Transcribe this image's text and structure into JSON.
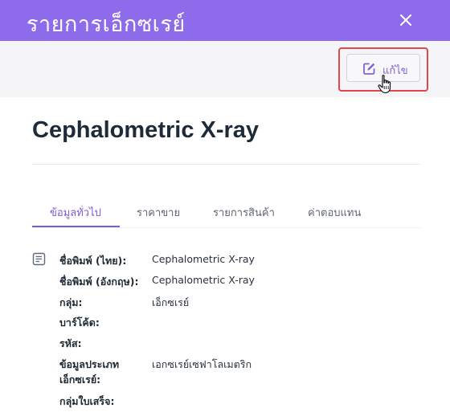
{
  "header": {
    "title": "รายการเอ็กซเรย์",
    "close_icon": "close-icon",
    "accent_color": "#8e6bea"
  },
  "toolbar": {
    "edit_label": "แก้ไข",
    "edit_icon": "edit-icon",
    "highlight_color": "#e0474c"
  },
  "product": {
    "title": "Cephalometric X-ray"
  },
  "tabs": [
    {
      "label": "ข้อมูลทั่วไป",
      "active": true
    },
    {
      "label": "ราคาขาย",
      "active": false
    },
    {
      "label": "รายการสินค้า",
      "active": false
    },
    {
      "label": "ค่าตอบแทน",
      "active": false
    }
  ],
  "general_info": {
    "icon": "document-icon",
    "rows": [
      {
        "label": "ชื่อพิมพ์ (ไทย):",
        "value": "Cephalometric X-ray"
      },
      {
        "label": "ชื่อพิมพ์ (อังกฤษ):",
        "value": "Cephalometric X-ray"
      },
      {
        "label": "กลุ่ม:",
        "value": "เอ็กซเรย์"
      },
      {
        "label": "บาร์โค้ด:",
        "value": ""
      },
      {
        "label": "รหัส:",
        "value": ""
      },
      {
        "label": "ข้อมูลประเภท",
        "label_line2": "เอ็กซเรย์:",
        "value": "เอกซเรย์เซฟาโลเมตริก"
      },
      {
        "label": "กลุ่มใบเสร็จ:",
        "value": ""
      }
    ]
  }
}
